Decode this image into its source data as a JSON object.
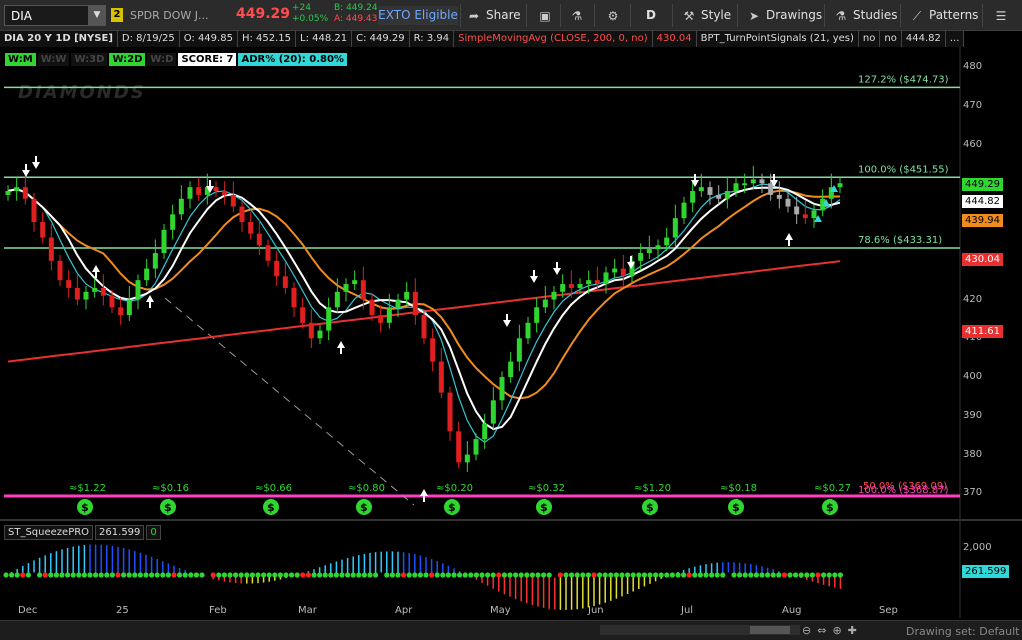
{
  "toolbar": {
    "symbol": "DIA",
    "link_num": "2",
    "description": "SPDR DOW J...",
    "last": "449.29",
    "change": "+24",
    "change_pct": "+0.05%",
    "bid": "B: 449.24",
    "ask": "A: 449.43",
    "exto": "EXTO Eligible",
    "share": "Share",
    "period": "D",
    "style": "Style",
    "drawings": "Drawings",
    "studies": "Studies",
    "patterns": "Patterns"
  },
  "infobar": {
    "title": "DIA 20 Y 1D [NYSE]",
    "date": "D: 8/19/25",
    "open": "O: 449.85",
    "high": "H: 452.15",
    "low": "L: 448.21",
    "close": "C: 449.29",
    "range": "R: 3.94",
    "sma_label": "SimpleMovingAvg (CLOSE, 200, 0, no)",
    "sma_value": "430.04",
    "bpt_label": "BPT_TurnPointSignals (21, yes)",
    "bpt_no1": "no",
    "bpt_no2": "no",
    "bpt_value": "444.82",
    "more": "..."
  },
  "tags": {
    "wm": "W:M",
    "ww": "W:W",
    "w3d": "W:3D",
    "w2d": "W:2D",
    "wd": "W:D",
    "score": "SCORE: 7",
    "adr": "ADR% (20): 0.80%"
  },
  "watermark": "DIAMONDS",
  "fib_labels": {
    "f127": "127.2%  ($474.73)",
    "f100": "100.0%  ($451.55)",
    "f786": "78.6%  ($433.31)",
    "f50": "50.0%  ($369.09)",
    "f100b": "100.0%  ($368.87)"
  },
  "dividends": [
    "≈$1.22",
    "≈$0.16",
    "≈$0.66",
    "≈$0.80",
    "≈$0.20",
    "≈$0.32",
    "≈$1.20",
    "≈$0.18",
    "≈$0.27"
  ],
  "price_axis": [
    "480",
    "470",
    "460",
    "450",
    "440",
    "430",
    "420",
    "410",
    "400",
    "390",
    "380",
    "370"
  ],
  "price_labels": {
    "last": "449.29",
    "ma1": "444.82",
    "ma2": "439.94",
    "sma200": "430.04",
    "low": "411.61"
  },
  "squeeze": {
    "title": "ST_SqueezePRO",
    "value": "261.599",
    "zero": "0",
    "axis_top": "2,000",
    "axis_value": "261.599"
  },
  "time_axis": [
    "Dec",
    "25",
    "Feb",
    "Mar",
    "Apr",
    "May",
    "Jun",
    "Jul",
    "Aug",
    "Sep"
  ],
  "status": {
    "drawing_set": "Drawing set: Default"
  },
  "colors": {
    "up": "#2fd62f",
    "down": "#e02020",
    "sma200": "#e83030",
    "ma_orange": "#f08c1e",
    "ma_white": "#ffffff",
    "ma_cyan": "#30c8d8",
    "fib": "#7fe0a0",
    "pink": "#ff40c0"
  }
}
